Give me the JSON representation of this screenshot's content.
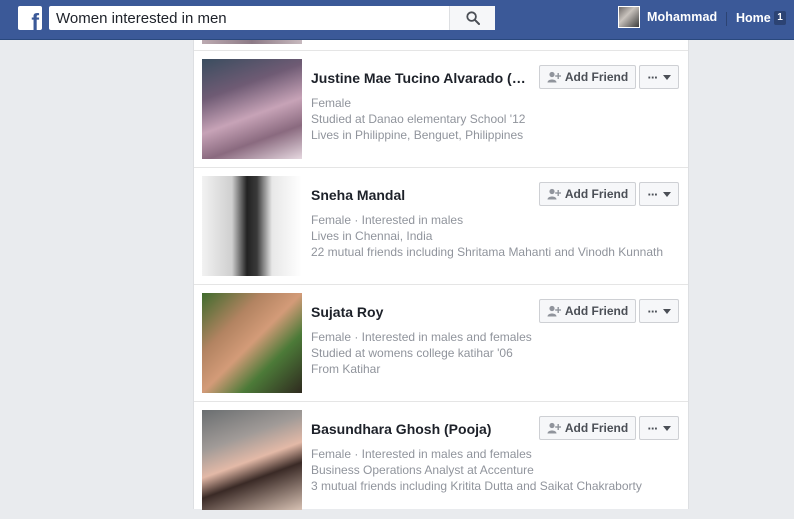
{
  "header": {
    "search_value": "Women interested in men",
    "user_name": "Mohammad",
    "home_label": "Home",
    "home_badge": "1",
    "brand_color": "#3b5998"
  },
  "results": [
    {
      "name": "Justine Mae Tucino Alvarado (Pi...",
      "details": [
        "Female",
        "Studied at Danao elementary School '12",
        "Lives in Philippine, Benguet, Philippines"
      ]
    },
    {
      "name": "Sneha Mandal",
      "details": [
        "Female · Interested in males",
        "Lives in Chennai, India",
        "22 mutual friends including Shritama Mahanti and Vinodh Kunnath"
      ]
    },
    {
      "name": "Sujata Roy",
      "details": [
        "Female · Interested in males and females",
        "Studied at womens college katihar '06",
        "From Katihar"
      ]
    },
    {
      "name": "Basundhara Ghosh (Pooja)",
      "details": [
        "Female · Interested in males and females",
        "Business Operations Analyst at Accenture",
        "3 mutual friends including Kritita Dutta and Saikat Chakraborty"
      ]
    }
  ],
  "actions": {
    "add_friend_label": "Add Friend",
    "more_label": "···"
  },
  "icons": {
    "logo": "facebook-logo",
    "search": "search-icon",
    "add_friend": "add-friend-icon",
    "more": "more-icon",
    "caret": "caret-down-icon"
  }
}
